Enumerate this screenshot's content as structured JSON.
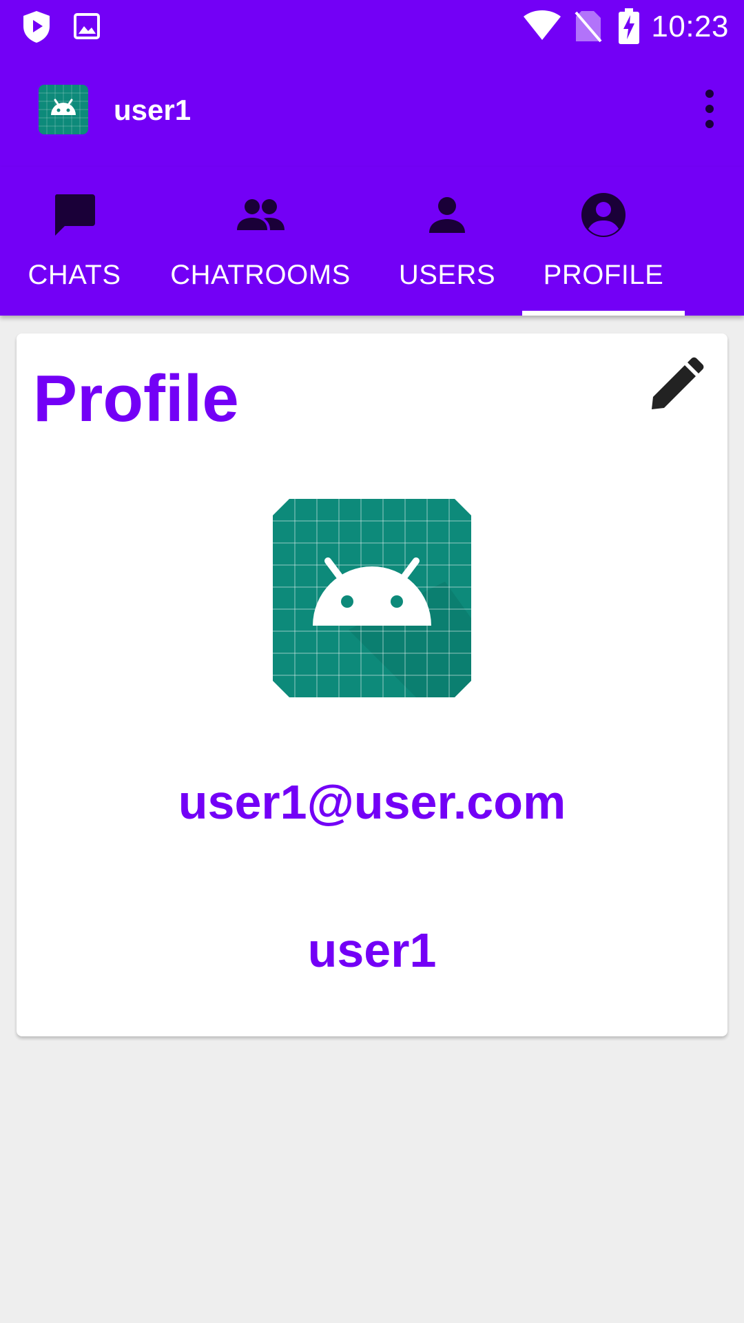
{
  "status_bar": {
    "time": "10:23",
    "icons": [
      "play-protect-icon",
      "image-notification-icon",
      "wifi-icon",
      "no-sim-icon",
      "battery-charging-icon"
    ]
  },
  "app_bar": {
    "title": "user1",
    "logo_icon": "android-app-icon",
    "menu_icon": "more-vert-icon"
  },
  "tabs": [
    {
      "label": "CHATS",
      "icon": "chat-icon",
      "selected": false
    },
    {
      "label": "CHATROOMS",
      "icon": "group-icon",
      "selected": false
    },
    {
      "label": "USERS",
      "icon": "person-icon",
      "selected": false
    },
    {
      "label": "PROFILE",
      "icon": "account-circle-icon",
      "selected": true
    }
  ],
  "profile": {
    "heading": "Profile",
    "email": "user1@user.com",
    "username": "user1",
    "edit_icon": "edit-icon"
  },
  "colors": {
    "primary": "#7300f6",
    "icon_dark": "#1a0038",
    "background": "#eeeeee",
    "android_green": "#0d8a7a"
  }
}
